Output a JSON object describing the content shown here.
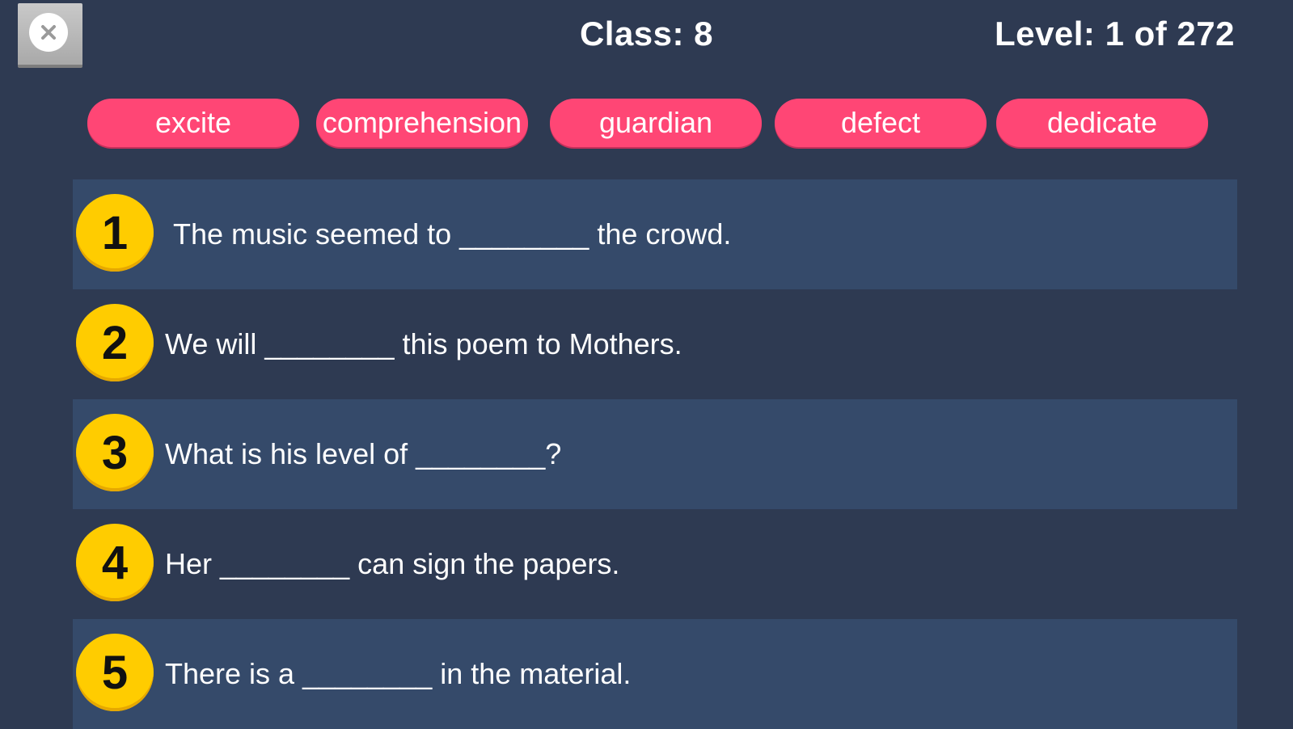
{
  "header": {
    "class_label": "Class: 8",
    "level_label": "Level: 1 of 272"
  },
  "word_bank": [
    "excite",
    "comprehension",
    "guardian",
    "defect",
    "dedicate"
  ],
  "questions": [
    {
      "number": "1",
      "text": "The music seemed to ________ the crowd."
    },
    {
      "number": "2",
      "text": "We will ________ this poem to Mothers."
    },
    {
      "number": "3",
      "text": "What is his level of ________?"
    },
    {
      "number": "4",
      "text": "Her ________ can sign the papers."
    },
    {
      "number": "5",
      "text": "There is a ________ in the material."
    }
  ],
  "colors": {
    "background": "#2e3a52",
    "row_shade": "#354a6a",
    "pill": "#ff4675",
    "badge": "#ffcc00"
  }
}
